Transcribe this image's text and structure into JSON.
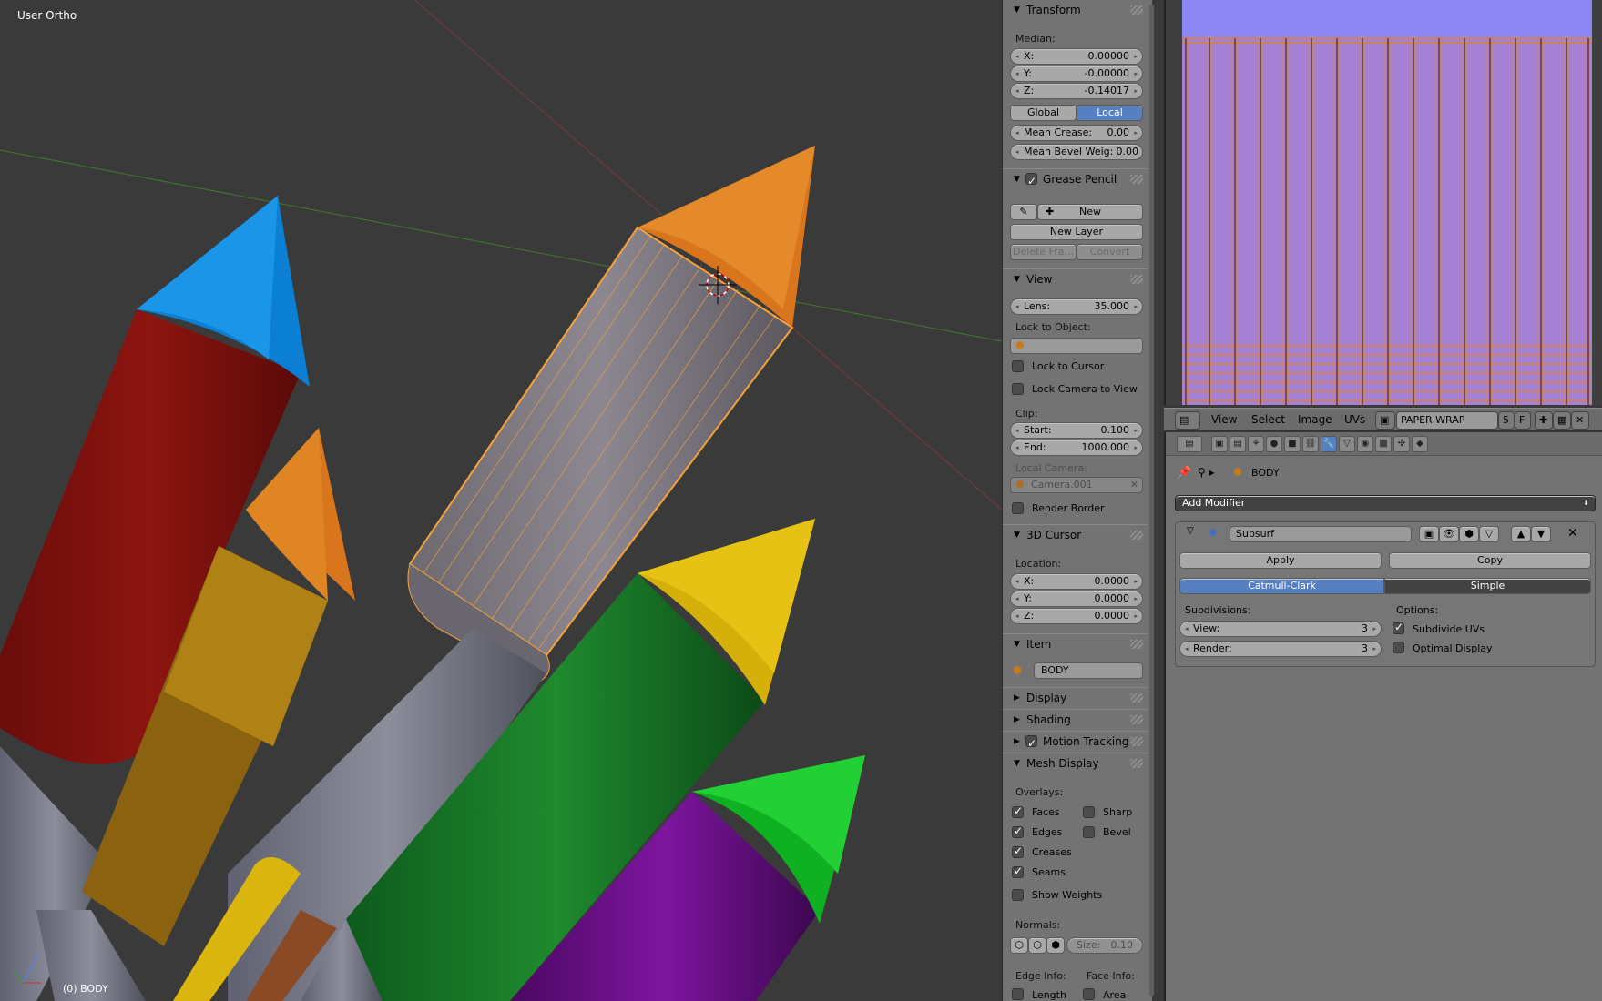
{
  "viewport": {
    "view_label": "User Ortho",
    "object_label": "(0) BODY"
  },
  "transform": {
    "title": "Transform",
    "median_label": "Median:",
    "x_label": "X:",
    "x_value": "0.00000",
    "y_label": "Y:",
    "y_value": "-0.00000",
    "z_label": "Z:",
    "z_value": "-0.14017",
    "global_label": "Global",
    "local_label": "Local",
    "crease_label": "Mean Crease:",
    "crease_value": "0.00",
    "bevel_label": "Mean Bevel Weig:",
    "bevel_value": "0.00"
  },
  "grease": {
    "title": "Grease Pencil",
    "new_label": "New",
    "new_layer_label": "New Layer",
    "delete_label": "Delete Fra...",
    "convert_label": "Convert"
  },
  "view": {
    "title": "View",
    "lens_label": "Lens:",
    "lens_value": "35.000",
    "lock_label": "Lock to Object:",
    "lock_cursor_label": "Lock to Cursor",
    "lock_camera_label": "Lock Camera to View",
    "clip_label": "Clip:",
    "start_label": "Start:",
    "start_value": "0.100",
    "end_label": "End:",
    "end_value": "1000.000",
    "local_camera_label": "Local Camera:",
    "camera_value": "Camera.001",
    "render_border_label": "Render Border"
  },
  "cursor": {
    "title": "3D Cursor",
    "location_label": "Location:",
    "x_label": "X:",
    "x_value": "0.0000",
    "y_label": "Y:",
    "y_value": "0.0000",
    "z_label": "Z:",
    "z_value": "0.0000"
  },
  "item": {
    "title": "Item",
    "name_value": "BODY"
  },
  "collapsed": {
    "display": "Display",
    "shading": "Shading",
    "motion": "Motion Tracking"
  },
  "mesh": {
    "title": "Mesh Display",
    "overlays_label": "Overlays:",
    "faces": "Faces",
    "sharp": "Sharp",
    "edges": "Edges",
    "bevel": "Bevel",
    "creases": "Creases",
    "seams": "Seams",
    "weights": "Show Weights",
    "normals_label": "Normals:",
    "size_label": "Size:",
    "size_value": "0.10",
    "edge_info_label": "Edge Info:",
    "face_info_label": "Face Info:",
    "length": "Length",
    "area": "Area"
  },
  "uv_header": {
    "view": "View",
    "select": "Select",
    "image": "Image",
    "uvs": "UVs",
    "image_name": "PAPER WRAP NOR...",
    "users": "5",
    "fake": "F"
  },
  "properties": {
    "object_name": "BODY",
    "add_modifier_label": "Add Modifier",
    "modifier_name": "Subsurf",
    "apply_label": "Apply",
    "copy_label": "Copy",
    "catmull_label": "Catmull-Clark",
    "simple_label": "Simple",
    "subdivisions_label": "Subdivisions:",
    "view_label": "View:",
    "view_value": "3",
    "render_label": "Render:",
    "render_value": "3",
    "options_label": "Options:",
    "subdivide_uvs_label": "Subdivide UVs",
    "optimal_label": "Optimal Display"
  },
  "colors": {
    "viewport_bg": "#3a3a3a",
    "panel_bg": "#737373",
    "accent": "#5680c2",
    "uv_fill": "#a581d5",
    "selection": "#f7a23a"
  }
}
